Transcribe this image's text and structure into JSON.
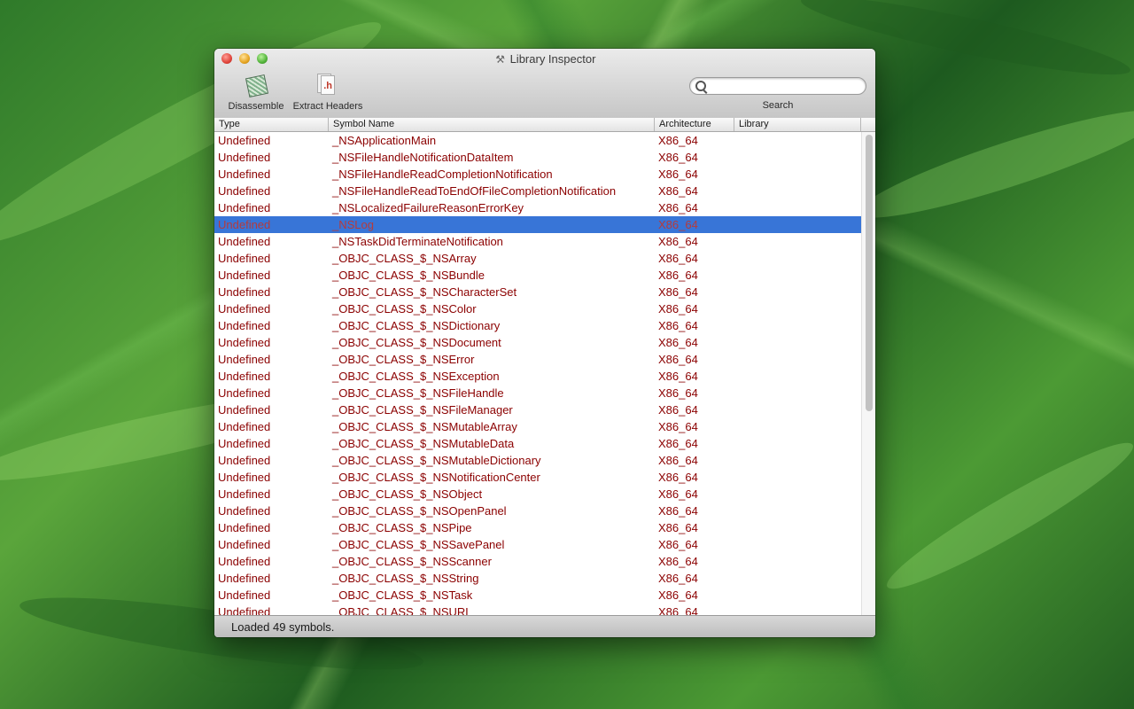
{
  "window": {
    "title": "Library Inspector"
  },
  "toolbar": {
    "disassemble_label": "Disassemble",
    "extract_headers_label": "Extract Headers",
    "search_label": "Search",
    "search_value": ""
  },
  "table": {
    "columns": [
      "Type",
      "Symbol Name",
      "Architecture",
      "Library"
    ],
    "selected_index": 5,
    "rows": [
      {
        "type": "Undefined",
        "symbol": "_NSApplicationMain",
        "arch": "X86_64",
        "library": ""
      },
      {
        "type": "Undefined",
        "symbol": "_NSFileHandleNotificationDataItem",
        "arch": "X86_64",
        "library": ""
      },
      {
        "type": "Undefined",
        "symbol": "_NSFileHandleReadCompletionNotification",
        "arch": "X86_64",
        "library": ""
      },
      {
        "type": "Undefined",
        "symbol": "_NSFileHandleReadToEndOfFileCompletionNotification",
        "arch": "X86_64",
        "library": ""
      },
      {
        "type": "Undefined",
        "symbol": "_NSLocalizedFailureReasonErrorKey",
        "arch": "X86_64",
        "library": ""
      },
      {
        "type": "Undefined",
        "symbol": "_NSLog",
        "arch": "X86_64",
        "library": ""
      },
      {
        "type": "Undefined",
        "symbol": "_NSTaskDidTerminateNotification",
        "arch": "X86_64",
        "library": ""
      },
      {
        "type": "Undefined",
        "symbol": "_OBJC_CLASS_$_NSArray",
        "arch": "X86_64",
        "library": ""
      },
      {
        "type": "Undefined",
        "symbol": "_OBJC_CLASS_$_NSBundle",
        "arch": "X86_64",
        "library": ""
      },
      {
        "type": "Undefined",
        "symbol": "_OBJC_CLASS_$_NSCharacterSet",
        "arch": "X86_64",
        "library": ""
      },
      {
        "type": "Undefined",
        "symbol": "_OBJC_CLASS_$_NSColor",
        "arch": "X86_64",
        "library": ""
      },
      {
        "type": "Undefined",
        "symbol": "_OBJC_CLASS_$_NSDictionary",
        "arch": "X86_64",
        "library": ""
      },
      {
        "type": "Undefined",
        "symbol": "_OBJC_CLASS_$_NSDocument",
        "arch": "X86_64",
        "library": ""
      },
      {
        "type": "Undefined",
        "symbol": "_OBJC_CLASS_$_NSError",
        "arch": "X86_64",
        "library": ""
      },
      {
        "type": "Undefined",
        "symbol": "_OBJC_CLASS_$_NSException",
        "arch": "X86_64",
        "library": ""
      },
      {
        "type": "Undefined",
        "symbol": "_OBJC_CLASS_$_NSFileHandle",
        "arch": "X86_64",
        "library": ""
      },
      {
        "type": "Undefined",
        "symbol": "_OBJC_CLASS_$_NSFileManager",
        "arch": "X86_64",
        "library": ""
      },
      {
        "type": "Undefined",
        "symbol": "_OBJC_CLASS_$_NSMutableArray",
        "arch": "X86_64",
        "library": ""
      },
      {
        "type": "Undefined",
        "symbol": "_OBJC_CLASS_$_NSMutableData",
        "arch": "X86_64",
        "library": ""
      },
      {
        "type": "Undefined",
        "symbol": "_OBJC_CLASS_$_NSMutableDictionary",
        "arch": "X86_64",
        "library": ""
      },
      {
        "type": "Undefined",
        "symbol": "_OBJC_CLASS_$_NSNotificationCenter",
        "arch": "X86_64",
        "library": ""
      },
      {
        "type": "Undefined",
        "symbol": "_OBJC_CLASS_$_NSObject",
        "arch": "X86_64",
        "library": ""
      },
      {
        "type": "Undefined",
        "symbol": "_OBJC_CLASS_$_NSOpenPanel",
        "arch": "X86_64",
        "library": ""
      },
      {
        "type": "Undefined",
        "symbol": "_OBJC_CLASS_$_NSPipe",
        "arch": "X86_64",
        "library": ""
      },
      {
        "type": "Undefined",
        "symbol": "_OBJC_CLASS_$_NSSavePanel",
        "arch": "X86_64",
        "library": ""
      },
      {
        "type": "Undefined",
        "symbol": "_OBJC_CLASS_$_NSScanner",
        "arch": "X86_64",
        "library": ""
      },
      {
        "type": "Undefined",
        "symbol": "_OBJC_CLASS_$_NSString",
        "arch": "X86_64",
        "library": ""
      },
      {
        "type": "Undefined",
        "symbol": "_OBJC_CLASS_$_NSTask",
        "arch": "X86_64",
        "library": ""
      },
      {
        "type": "Undefined",
        "symbol": "_OBJC_CLASS_$_NSURL",
        "arch": "X86_64",
        "library": ""
      }
    ]
  },
  "status": {
    "text": "Loaded 49 symbols."
  },
  "colors": {
    "row_text": "#8b0000",
    "selection": "#3875d7"
  }
}
